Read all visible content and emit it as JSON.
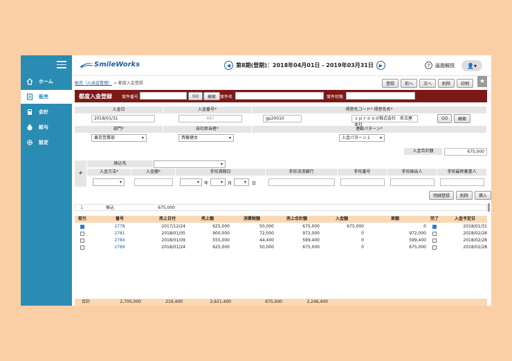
{
  "sidebar": {
    "items": [
      {
        "label": "ホーム",
        "icon": "home-icon"
      },
      {
        "label": "販売",
        "icon": "document-icon"
      },
      {
        "label": "会計",
        "icon": "calculator-icon"
      },
      {
        "label": "給与",
        "icon": "coin-bag-icon"
      },
      {
        "label": "設定",
        "icon": "gear-icon"
      }
    ],
    "active": 1
  },
  "header": {
    "logo": "SmileWorks",
    "period": "第8期(登期)：2018年04月01日 - 2019年03月31日",
    "help": "画面解説"
  },
  "breadcrumb": {
    "parent": "販売（入出金管理）",
    "sep": ">",
    "current": "都度入金登録"
  },
  "toolbar": {
    "register": "登録",
    "prev": "前へ",
    "next": "次へ",
    "delete": "削除",
    "print": "印刷"
  },
  "form_header": {
    "title": "都度入金登録",
    "case_no_label": "案件番号",
    "go": "GO",
    "search": "検索",
    "case_name_label": "案件名",
    "case_status_label": "案件状態"
  },
  "form": {
    "date_label": "入金日",
    "date": "2018/01/31",
    "no_label": "入金番号",
    "no": "467",
    "cust_label": "得意先コード",
    "cust_name_label": "得意先名",
    "cust_code": "gp20010",
    "cust_name": "ｓｐｒｅａｄ株式会社　名古屋本社",
    "dept_label": "部門",
    "dept": "東京営業部",
    "staff_label": "自社担当者",
    "staff": "斉藤健太",
    "pattern_label": "連動パターン",
    "pattern": "入金パターン１",
    "total_label": "入金合計額",
    "total": "675,000",
    "req": "*"
  },
  "detail_head": {
    "hash": "#",
    "dest": "振込先",
    "method": "入金方法",
    "amount": "入金額",
    "due": "手形満期日",
    "bank": "手形決済銀行",
    "bill_no": "手形番号",
    "drawer": "手形振出人",
    "endorser": "手形最終裏書人",
    "year": "年",
    "month": "月",
    "day": "日"
  },
  "detail_buttons": {
    "register": "明細登録",
    "delete": "削除",
    "insert": "挿入"
  },
  "detail_rows": [
    {
      "no": "1",
      "method": "振込",
      "amount": "675,000"
    }
  ],
  "invoice_table": {
    "columns": [
      "取引",
      "番号",
      "売上日付",
      "売上額",
      "消費税額",
      "売上合計額",
      "入金額",
      "差額",
      "完了",
      "入金予定日"
    ],
    "rows": [
      {
        "take": true,
        "no": "2778",
        "date": "2017/12/24",
        "sales": "625,000",
        "tax": "50,000",
        "total": "675,000",
        "paid": "675,000",
        "diff": "0",
        "done": true,
        "due": "2018/01/31"
      },
      {
        "take": false,
        "no": "2781",
        "date": "2018/01/05",
        "sales": "900,000",
        "tax": "72,000",
        "total": "972,000",
        "paid": "0",
        "diff": "972,000",
        "done": false,
        "due": "2018/02/28"
      },
      {
        "take": false,
        "no": "2784",
        "date": "2018/01/09",
        "sales": "555,000",
        "tax": "44,400",
        "total": "599,400",
        "paid": "0",
        "diff": "599,400",
        "done": false,
        "due": "2018/02/28"
      },
      {
        "take": false,
        "no": "2789",
        "date": "2018/01/24",
        "sales": "625,000",
        "tax": "50,000",
        "total": "675,000",
        "paid": "0",
        "diff": "675,000",
        "done": false,
        "due": "2018/02/28"
      }
    ],
    "footer": {
      "label": "合計",
      "a": "2,705,000",
      "b": "216,400",
      "c": "2,921,400",
      "d": "675,000",
      "e": "2,246,400"
    }
  },
  "colors": {
    "sidebar": "#2b8cb3",
    "title_bar": "#7b1818",
    "table_header": "#fbd8b4",
    "page_bg": "#fbcfa6"
  }
}
